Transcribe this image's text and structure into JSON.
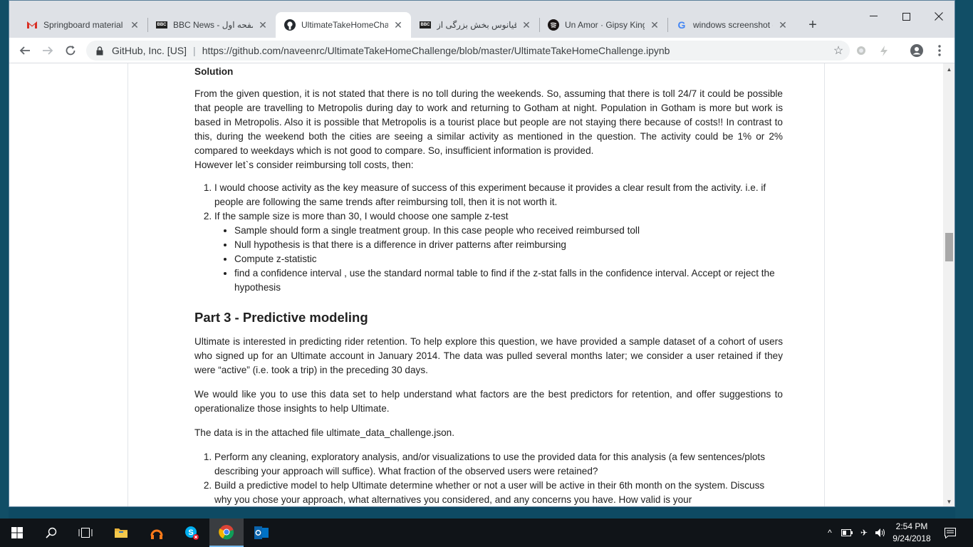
{
  "tabs": [
    {
      "title": "Springboard material - ",
      "favicon": "gmail-icon"
    },
    {
      "title": "BBC News - صفحه اول",
      "favicon": "bbc-icon"
    },
    {
      "title": "UltimateTakeHomeCha",
      "favicon": "github-icon"
    },
    {
      "title": "اقیانوس بخش بزرگی از",
      "favicon": "bbc-icon"
    },
    {
      "title": "Un Amor · Gipsy Kings",
      "favicon": "spotify-icon"
    },
    {
      "title": "windows screenshot - ",
      "favicon": "google-icon"
    }
  ],
  "address": {
    "site": "GitHub, Inc. [US]",
    "url": "https://github.com/naveenrc/UltimateTakeHomeChallenge/blob/master/UltimateTakeHomeChallenge.ipynb"
  },
  "notebook": {
    "solution_heading": "Solution",
    "solution_para": "From the given question, it is not stated that there is no toll during the weekends. So, assuming that there is toll 24/7 it could be possible that people are travelling to Metropolis during day to work and returning to Gotham at night. Population in Gotham is more but work is based in Metropolis. Also it is possible that Metropolis is a tourist place but people are not staying there because of costs!! In contrast to this, during the weekend both the cities are seeing a similar activity as mentioned in the question. The activity could be 1% or 2% compared to weekdays which is not good to compare. So, insufficient information is provided.",
    "solution_line": "However let`s consider reimbursing toll costs, then:",
    "steps": [
      "I would choose activity as the key measure of success of this experiment because it provides a clear result from the activity. i.e. if people are following the same trends after reimbursing toll, then it is not worth it.",
      "If the sample size is more than 30, I would choose one sample z-test"
    ],
    "substeps": [
      "Sample should form a single treatment group. In this case people who received reimbursed toll",
      "Null hypothesis is that there is a difference in driver patterns after reimbursing",
      "Compute z-statistic",
      "find a confidence interval , use the standard normal table to find if the z-stat falls in the confidence interval. Accept or reject the hypothesis"
    ],
    "part3_heading": "Part 3 - Predictive modeling",
    "part3_p1": "Ultimate is interested in predicting rider retention. To help explore this question, we have provided a sample dataset of a cohort of users who signed up for an Ultimate account in January 2014. The data was pulled several months later; we consider a user retained if they were “active” (i.e. took a trip) in the preceding 30 days.",
    "part3_p2": "We would like you to use this data set to help understand what factors are the best predictors for retention, and offer suggestions to operationalize those insights to help Ultimate.",
    "part3_p3": "The data is in the attached file ultimate_data_challenge.json.",
    "tasks": [
      "Perform any cleaning, exploratory analysis, and/or visualizations to use the provided data for this analysis (a few sentences/plots describing your approach will suffice). What fraction of the observed users were retained?",
      "Build a predictive model to help Ultimate determine whether or not a user will be active in their 6th month on the system. Discuss why you chose your approach, what alternatives you considered, and any concerns you have. How valid is your"
    ]
  },
  "clock": {
    "time": "2:54 PM",
    "date": "9/24/2018"
  },
  "colors": {
    "accent": "#76b9ed",
    "taskbar": "#101418",
    "tabstrip": "#dee1e6"
  }
}
